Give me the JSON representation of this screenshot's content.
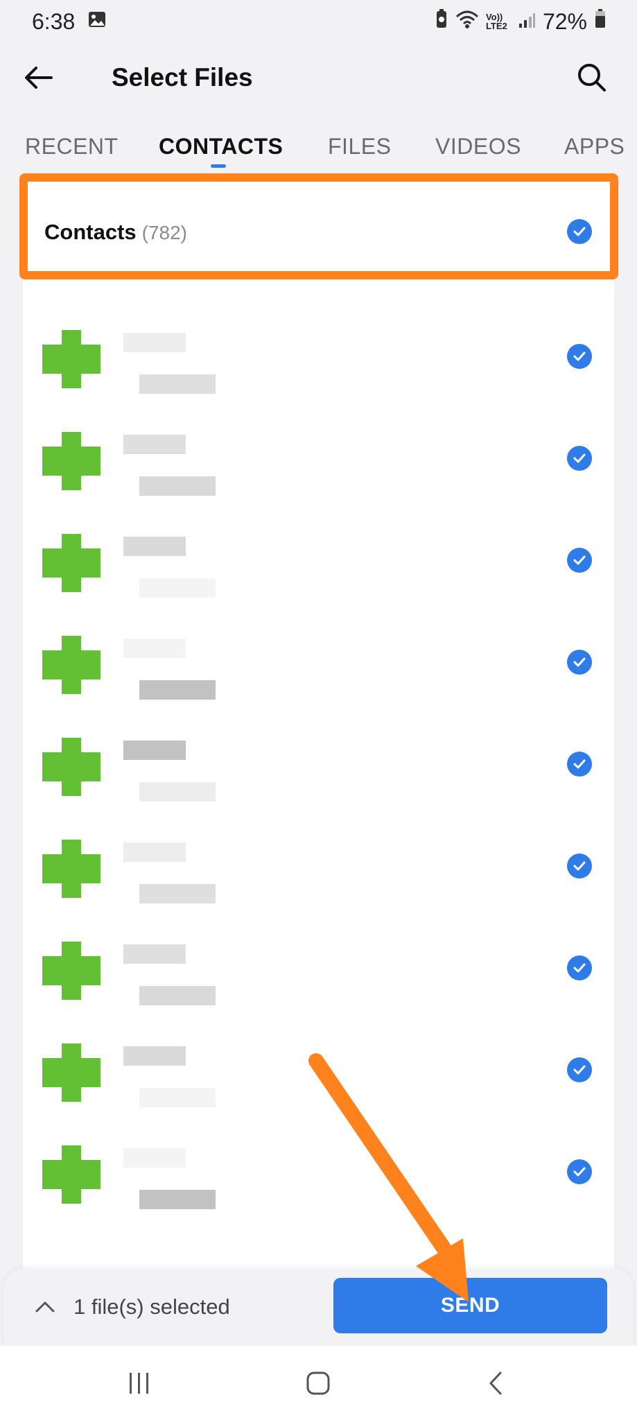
{
  "status": {
    "time": "6:38",
    "network_label": "Vo)) LTE2",
    "battery": "72%"
  },
  "header": {
    "title": "Select Files",
    "back_icon": "arrow-left-icon",
    "search_icon": "search-icon"
  },
  "tabs": [
    {
      "label": "RECENT",
      "active": false
    },
    {
      "label": "CONTACTS",
      "active": true
    },
    {
      "label": "FILES",
      "active": false
    },
    {
      "label": "VIDEOS",
      "active": false
    },
    {
      "label": "APPS",
      "active": false
    }
  ],
  "contacts_header": {
    "label": "Contacts",
    "count": "(782)",
    "selected": true
  },
  "contacts": [
    {
      "selected": true
    },
    {
      "selected": true
    },
    {
      "selected": true
    },
    {
      "selected": true
    },
    {
      "selected": true
    },
    {
      "selected": true
    },
    {
      "selected": true
    },
    {
      "selected": true
    },
    {
      "selected": true
    }
  ],
  "bottom": {
    "selected_text": "1 file(s) selected",
    "send_label": "SEND"
  },
  "colors": {
    "accent": "#2f7ce8",
    "highlight": "#ff821c",
    "avatar": "#63c035"
  }
}
